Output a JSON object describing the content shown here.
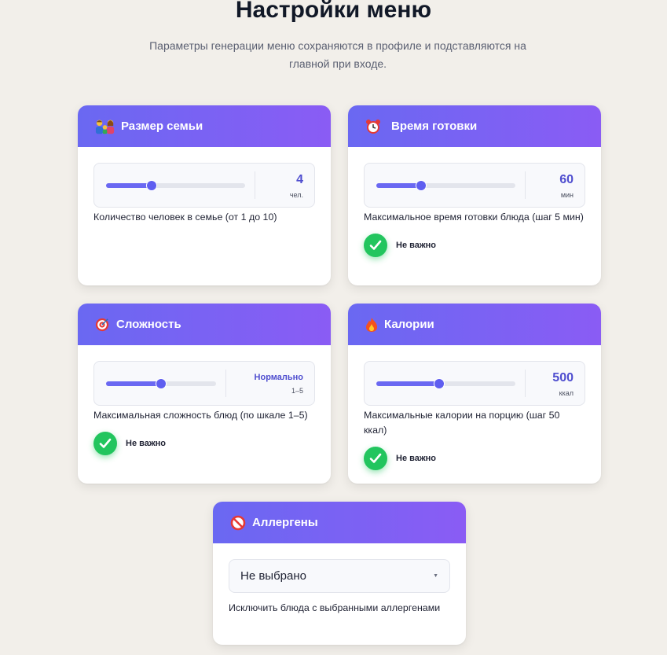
{
  "header": {
    "title": "Настройки меню",
    "subtitle": "Параметры генерации меню сохраняются в профиле и подставляются на главной при входе."
  },
  "cards": {
    "family": {
      "title": "Размер семьи",
      "icon": "family-icon",
      "value": "4",
      "unit": "чел.",
      "level": 0.33,
      "description": "Количество человек в семье (от 1 до 10)"
    },
    "time": {
      "title": "Время готовки",
      "icon": "alarm-clock-icon",
      "value": "60",
      "unit": "мин",
      "level": 0.32,
      "description": "Максимальное время готовки блюда (шаг 5 мин)",
      "toggle_label": "Не важно",
      "toggle_checked": true
    },
    "difficulty": {
      "title": "Сложность",
      "icon": "target-icon",
      "value": "Нормально",
      "range": "1–5",
      "level": 0.5,
      "description": "Максимальная сложность блюд (по шкале 1–5)",
      "toggle_label": "Не важно",
      "toggle_checked": true
    },
    "calories": {
      "title": "Калории",
      "icon": "fire-icon",
      "value": "500",
      "unit": "ккал",
      "level": 0.45,
      "description": "Максимальные калории на порцию (шаг 50 ккал)",
      "toggle_label": "Не важно",
      "toggle_checked": true
    },
    "allergens": {
      "title": "Аллергены",
      "icon": "prohibited-icon",
      "selected": "Не выбрано",
      "description": "Исключить блюда с выбранными аллергенами"
    }
  },
  "colors": {
    "accent": "#6a68f2",
    "header_gradient_end": "#8a5cf4",
    "check": "#22c55e",
    "background": "#f2efea"
  }
}
